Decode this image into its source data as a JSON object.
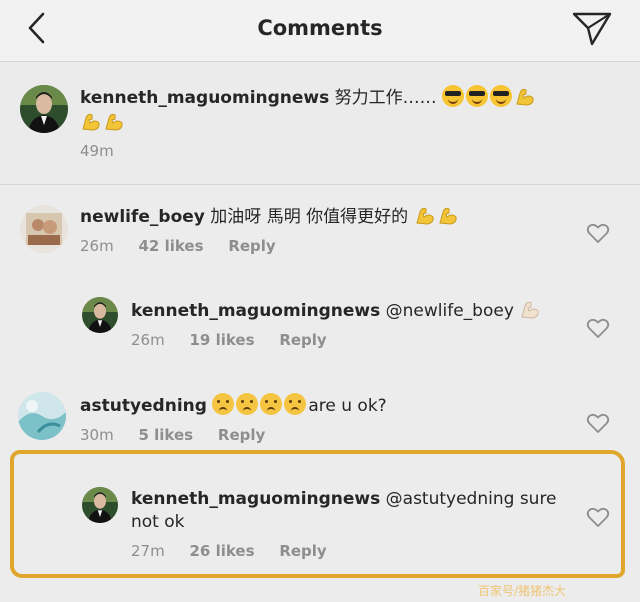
{
  "header": {
    "title": "Comments",
    "back_icon": "chevron-left-icon",
    "send_icon": "paper-plane-icon"
  },
  "caption": {
    "username": "kenneth_maguomingnews",
    "text": "努力工作……",
    "time": "49m"
  },
  "comments": [
    {
      "username": "newlife_boey",
      "text": "加油呀 馬明 你值得更好的",
      "time": "26m",
      "likes": "42 likes",
      "reply": "Reply"
    },
    {
      "username": "kenneth_maguomingnews",
      "text": "@newlife_boey",
      "time": "26m",
      "likes": "19 likes",
      "reply": "Reply"
    },
    {
      "username": "astutyedning",
      "text": "are u ok?",
      "time": "30m",
      "likes": "5 likes",
      "reply": "Reply"
    },
    {
      "username": "kenneth_maguomingnews",
      "text_line1": "@astutyedning sure",
      "text_line2": "not ok",
      "time": "27m",
      "likes": "26 likes",
      "reply": "Reply"
    }
  ],
  "watermark": "百家号/猪猪杰大"
}
